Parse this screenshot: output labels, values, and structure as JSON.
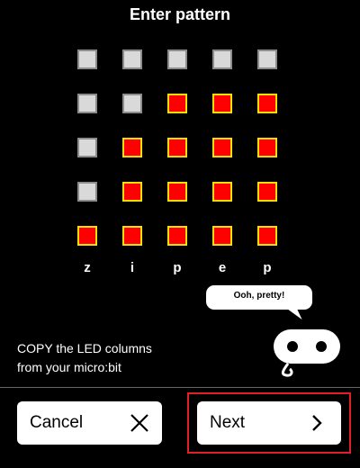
{
  "title": "Enter pattern",
  "grid": [
    [
      0,
      0,
      0,
      0,
      0
    ],
    [
      0,
      0,
      1,
      1,
      1
    ],
    [
      0,
      1,
      1,
      1,
      1
    ],
    [
      0,
      1,
      1,
      1,
      1
    ],
    [
      1,
      1,
      1,
      1,
      1
    ]
  ],
  "column_letters": [
    "z",
    "i",
    "p",
    "e",
    "p"
  ],
  "instruction": {
    "line1": "COPY the LED columns",
    "line2": "from your micro:bit"
  },
  "speech_bubble": "Ooh, pretty!",
  "buttons": {
    "cancel": "Cancel",
    "next": "Next"
  },
  "colors": {
    "led_on": "#ff0000",
    "led_on_border": "#ffe000",
    "led_off": "#d9d9d9",
    "led_off_border": "#8c8c8c",
    "highlight": "#e21f26"
  }
}
